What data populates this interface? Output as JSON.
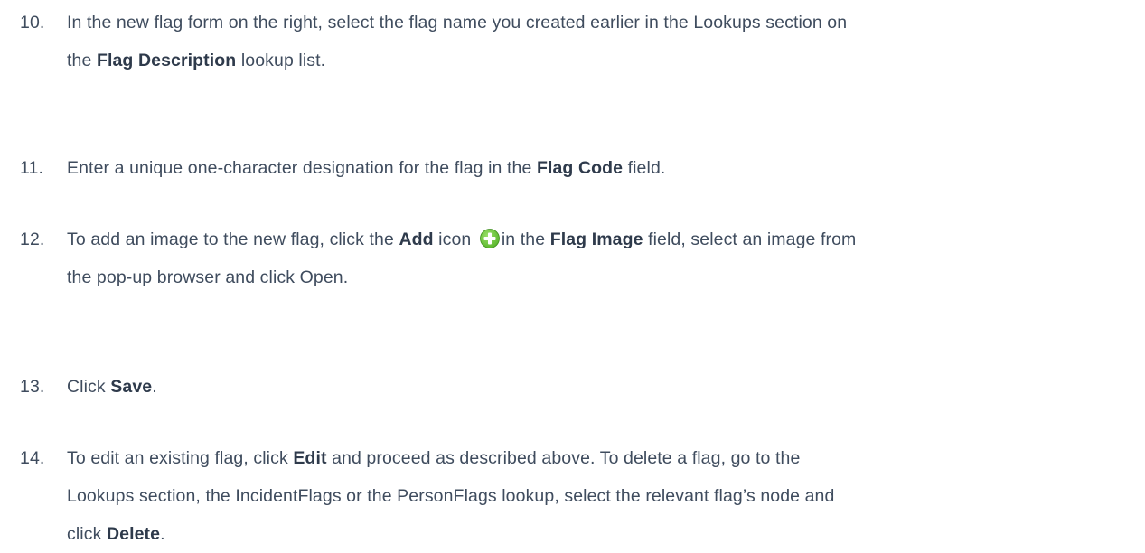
{
  "steps": [
    {
      "number": "10.",
      "lines": [
        [
          {
            "t": "In the new flag form on the right, select the flag name you created earlier in the Lookups section on"
          }
        ],
        [
          {
            "t": "the "
          },
          {
            "t": "Flag Description",
            "b": true
          },
          {
            "t": " lookup list."
          }
        ]
      ]
    },
    {
      "number": "11.",
      "lines": [
        [
          {
            "t": "Enter a unique one-character designation for the flag in the "
          },
          {
            "t": "Flag Code",
            "b": true
          },
          {
            "t": " field."
          }
        ]
      ]
    },
    {
      "number": "12.",
      "lines": [
        [
          {
            "t": "To add an image to the new flag, click the "
          },
          {
            "t": "Add",
            "b": true
          },
          {
            "t": " icon "
          },
          {
            "icon": "add-icon"
          },
          {
            "t": "in the "
          },
          {
            "t": "Flag Image",
            "b": true
          },
          {
            "t": " field, select an image from"
          }
        ],
        [
          {
            "t": "the pop-up browser and click Open."
          }
        ]
      ]
    },
    {
      "number": "13.",
      "lines": [
        [
          {
            "t": "Click "
          },
          {
            "t": "Save",
            "b": true
          },
          {
            "t": "."
          }
        ]
      ]
    },
    {
      "number": "14.",
      "lines": [
        [
          {
            "t": "To edit an existing flag, click "
          },
          {
            "t": "Edit",
            "b": true
          },
          {
            "t": " and proceed as described above. To delete a flag, go to the"
          }
        ],
        [
          {
            "t": "Lookups section, the IncidentFlags or the PersonFlags lookup, select the relevant flag’s node and"
          }
        ],
        [
          {
            "t": "click "
          },
          {
            "t": "Delete",
            "b": true
          },
          {
            "t": "."
          }
        ]
      ]
    }
  ],
  "colors": {
    "text": "#3f4c5e",
    "add_icon_green": "#5cb82e"
  }
}
